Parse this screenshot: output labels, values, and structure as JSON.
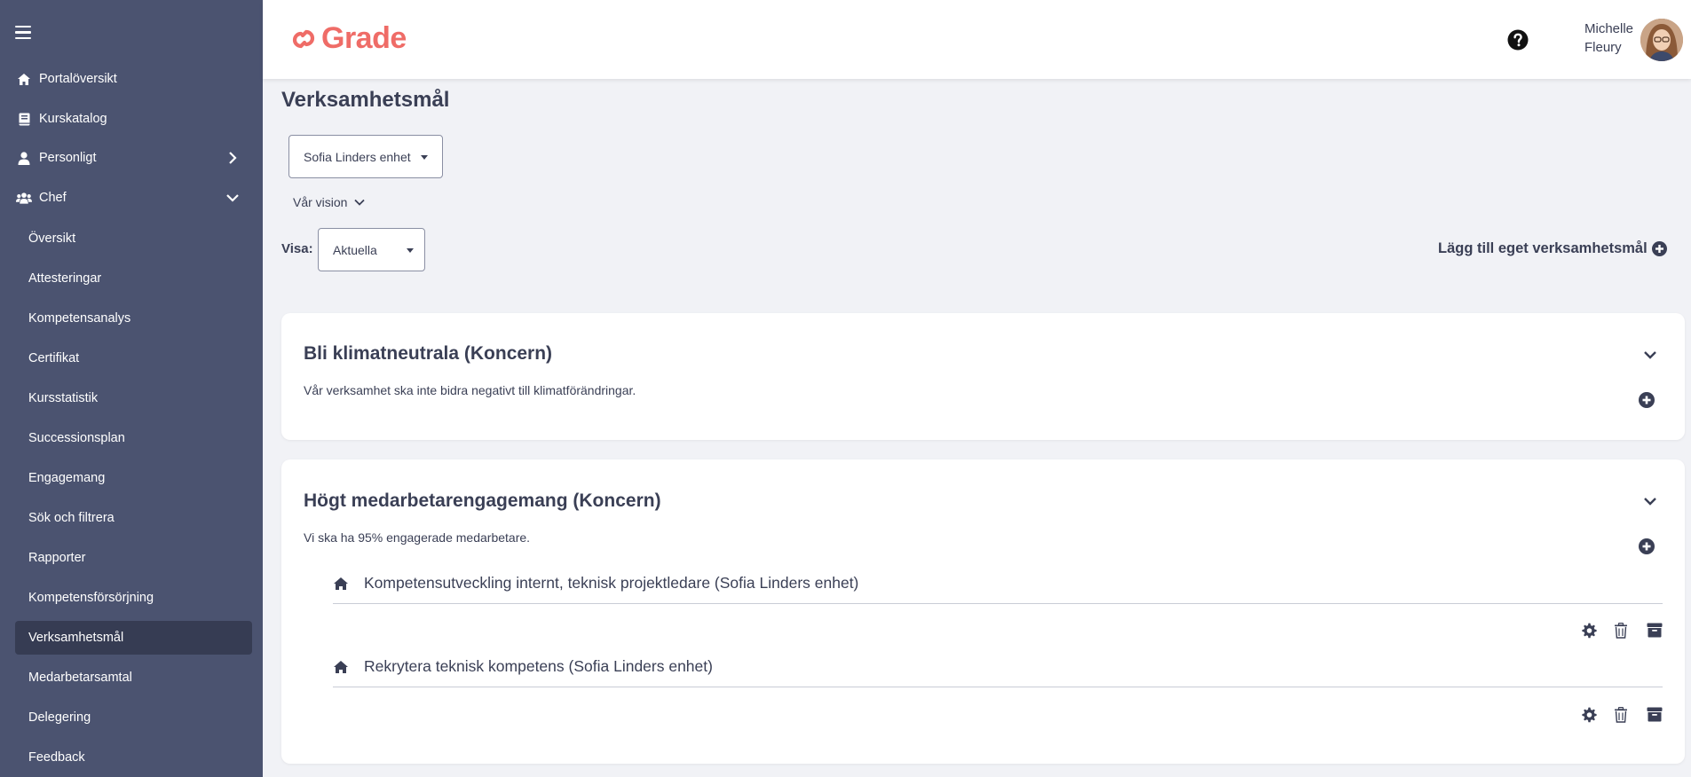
{
  "app": {
    "logo_text": "Grade",
    "brand_color": "#ef6c67",
    "sidebar_color": "#4b5370"
  },
  "sidebar": {
    "main_items": [
      {
        "label": "Portalöversikt",
        "icon": "home-icon"
      },
      {
        "label": "Kurskatalog",
        "icon": "book-icon"
      },
      {
        "label": "Personligt",
        "icon": "user-icon",
        "chevron": "chevron-right-icon"
      },
      {
        "label": "Chef",
        "icon": "users-icon",
        "chevron": "chevron-down-icon"
      }
    ],
    "sub_items": [
      {
        "label": "Översikt"
      },
      {
        "label": "Attesteringar"
      },
      {
        "label": "Kompetensanalys"
      },
      {
        "label": "Certifikat"
      },
      {
        "label": "Kursstatistik"
      },
      {
        "label": "Successionsplan"
      },
      {
        "label": "Engagemang"
      },
      {
        "label": "Sök och filtrera"
      },
      {
        "label": "Rapporter"
      },
      {
        "label": "Kompetensförsörjning"
      },
      {
        "label": "Verksamhetsmål",
        "active": true
      },
      {
        "label": "Medarbetarsamtal"
      },
      {
        "label": "Delegering"
      },
      {
        "label": "Feedback"
      }
    ]
  },
  "header": {
    "user_first": "Michelle",
    "user_last": "Fleury"
  },
  "main": {
    "title": "Verksamhetsmål",
    "unit_select": "Sofia Linders enhet",
    "vision_label": "Vår vision",
    "visa_label": "Visa:",
    "visa_select": "Aktuella",
    "add_goal_label": "Lägg till eget verksamhetsmål"
  },
  "goals": [
    {
      "title": "Bli klimatneutrala (Koncern)",
      "description": "Vår verksamhet ska inte bidra negativt till klimatförändringar.",
      "subgoals": []
    },
    {
      "title": "Högt medarbetarengagemang (Koncern)",
      "description": "Vi ska ha 95% engagerade medarbetare.",
      "subgoals": [
        {
          "title": "Kompetensutveckling internt, teknisk projektledare (Sofia Linders enhet)"
        },
        {
          "title": "Rekrytera teknisk kompetens (Sofia Linders enhet)"
        }
      ]
    }
  ]
}
